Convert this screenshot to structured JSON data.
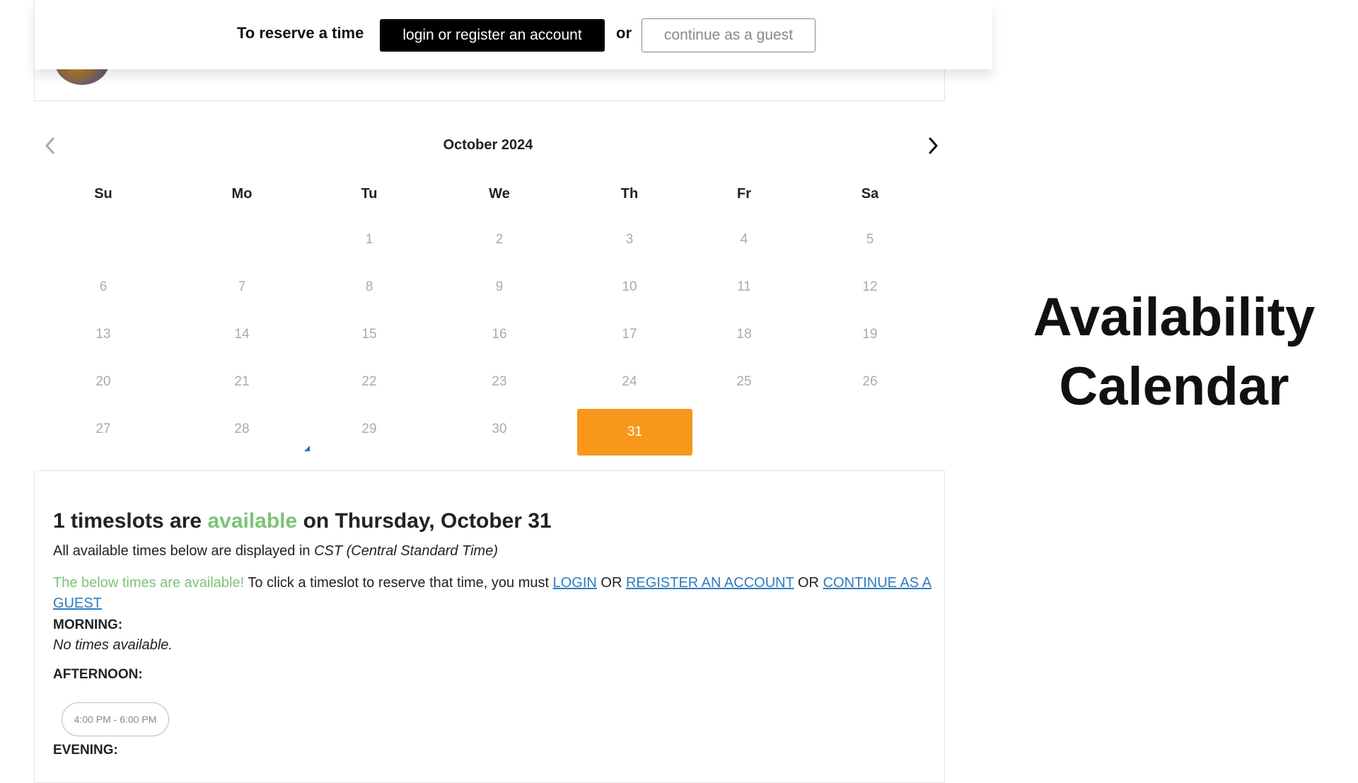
{
  "banner": {
    "label": "To reserve a time",
    "login_button": "login or register an account",
    "or_text": "or",
    "guest_button": "continue as a guest"
  },
  "calendar": {
    "month_label": "October 2024",
    "weekdays": [
      "Su",
      "Mo",
      "Tu",
      "We",
      "Th",
      "Fr",
      "Sa"
    ],
    "days": [
      {
        "day": "1",
        "col": 2
      },
      {
        "day": "2",
        "col": 3
      },
      {
        "day": "3",
        "col": 4
      },
      {
        "day": "4",
        "col": 5
      },
      {
        "day": "5",
        "col": 6
      },
      {
        "day": "6",
        "col": 0
      },
      {
        "day": "7",
        "col": 1
      },
      {
        "day": "8",
        "col": 2
      },
      {
        "day": "9",
        "col": 3
      },
      {
        "day": "10",
        "col": 4
      },
      {
        "day": "11",
        "col": 5
      },
      {
        "day": "12",
        "col": 6
      },
      {
        "day": "13",
        "col": 0
      },
      {
        "day": "14",
        "col": 1
      },
      {
        "day": "15",
        "col": 2
      },
      {
        "day": "16",
        "col": 3
      },
      {
        "day": "17",
        "col": 4
      },
      {
        "day": "18",
        "col": 5
      },
      {
        "day": "19",
        "col": 6
      },
      {
        "day": "20",
        "col": 0
      },
      {
        "day": "21",
        "col": 1
      },
      {
        "day": "22",
        "col": 2
      },
      {
        "day": "23",
        "col": 3
      },
      {
        "day": "24",
        "col": 4
      },
      {
        "day": "25",
        "col": 5
      },
      {
        "day": "26",
        "col": 6
      },
      {
        "day": "27",
        "col": 0
      },
      {
        "day": "28",
        "col": 1
      },
      {
        "day": "29",
        "col": 2
      },
      {
        "day": "30",
        "col": 3
      }
    ],
    "selected_day": "31",
    "selected_color": "#f7981d"
  },
  "slots": {
    "heading_pre": "1 timeslots are",
    "heading_available": "available",
    "heading_post": "on Thursday, October 31",
    "tz_prefix": "All available times below are displayed in",
    "tz_value": "CST (Central Standard Time)",
    "instr_available": "The below times are available!",
    "instr_text": "To click a timeslot to reserve that time, you must",
    "login_link": "LOGIN",
    "or1": "OR",
    "register_link": "REGISTER AN ACCOUNT",
    "or2": "OR",
    "continue_link": "CONTINUE AS A GUEST",
    "morning_label": "MORNING:",
    "morning_none": "No times available.",
    "afternoon_label": "AFTERNOON:",
    "afternoon_slot": "4:00 PM - 6:00 PM",
    "evening_label": "EVENING:"
  },
  "side_title": {
    "line1": "Availability",
    "line2": "Calendar"
  },
  "colors": {
    "accent_orange": "#f7981d",
    "available_green": "#7cc37a",
    "link_blue": "#2f7bbd"
  }
}
